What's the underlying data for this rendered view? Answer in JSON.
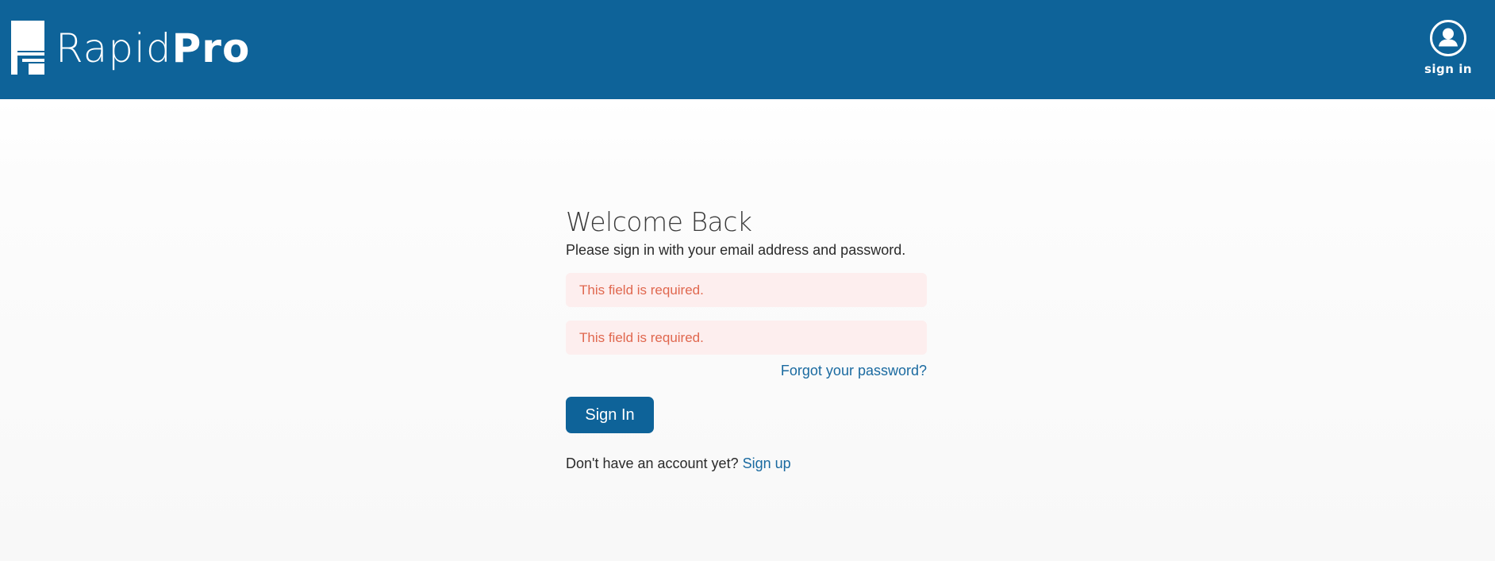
{
  "header": {
    "brand_light": "Rapid",
    "brand_bold": "Pro",
    "user_menu_label": "sign in",
    "background_color": "#0e6399"
  },
  "login": {
    "title": "Welcome Back",
    "subtitle": "Please sign in with your email address and password.",
    "email_error": "This field is required.",
    "password_error": "This field is required.",
    "forgot_link": "Forgot your password?",
    "submit_label": "Sign In",
    "signup_prompt": "Don't have an account yet?",
    "signup_link": "Sign up"
  },
  "colors": {
    "accent": "#0e6399",
    "error_text": "#e0674e",
    "error_background": "#fdeeee",
    "link": "#1a6aa0"
  },
  "icons": {
    "logo": "rapidpro-logo-icon",
    "user": "user-circle-icon"
  }
}
